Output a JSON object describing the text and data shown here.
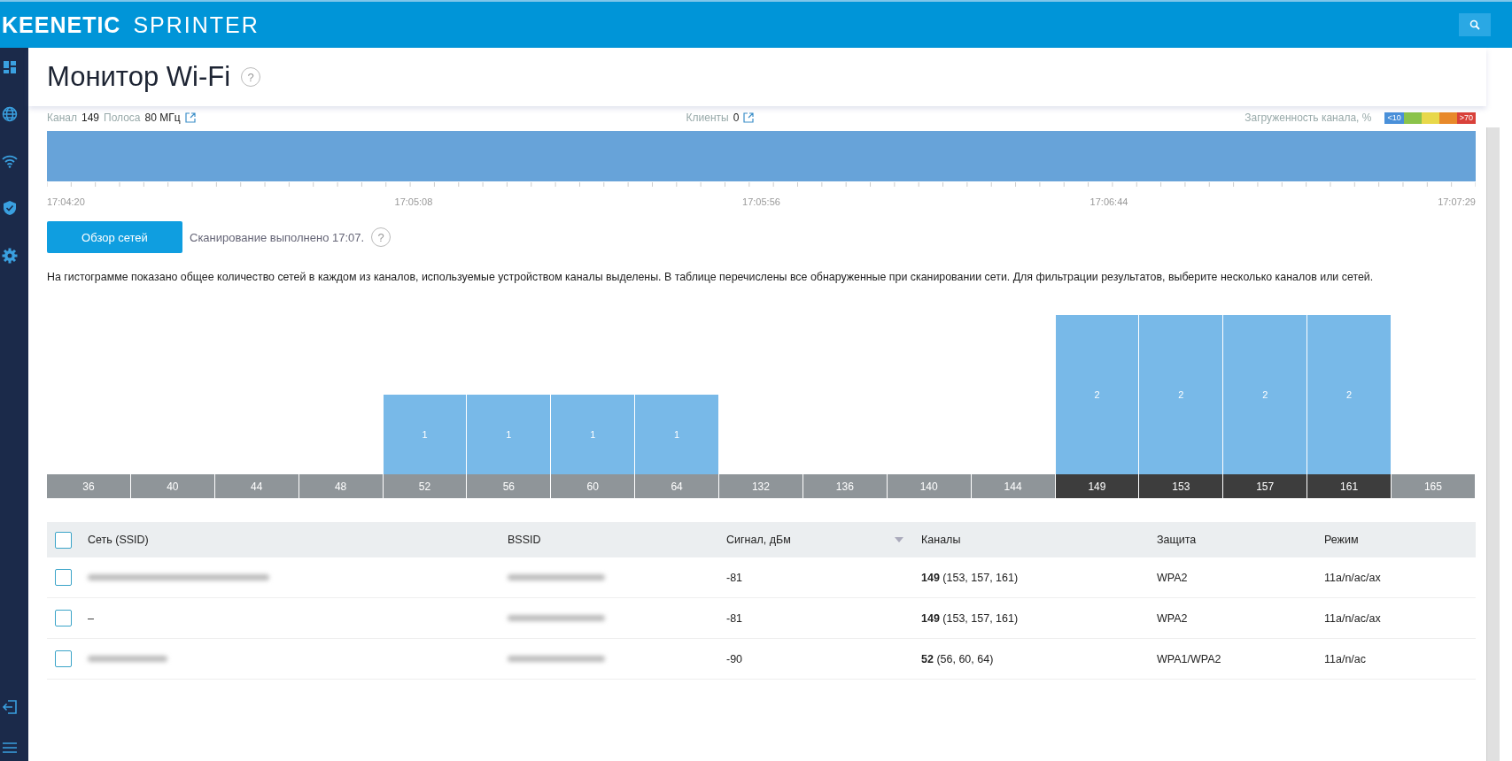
{
  "brand": {
    "name": "KEENETIC",
    "model": "SPRINTER"
  },
  "page": {
    "title": "Монитор Wi-Fi",
    "help": "?"
  },
  "load_strip": {
    "channel_label": "Канал",
    "channel": "149",
    "band_label": "Полоса",
    "band": "80 МГц",
    "clients_label": "Клиенты",
    "clients": "0",
    "load_label": "Загруженность канала, %",
    "legend": [
      {
        "label": "<10",
        "color": "#4a90d9"
      },
      {
        "color": "#8bc34a"
      },
      {
        "color": "#e8d84a"
      },
      {
        "color": "#e8892a"
      },
      {
        "label": ">70",
        "color": "#d9413a"
      }
    ],
    "time_labels": [
      "17:04:20",
      "17:05:08",
      "17:05:56",
      "17:06:44",
      "17:07:29"
    ]
  },
  "scan": {
    "button": "Обзор сетей",
    "status": "Сканирование выполнено 17:07.",
    "help": "?"
  },
  "description": "На гистограмме показано общее количество сетей в каждом из каналов, используемые устройством каналы выделены. В таблице перечислены все обнаруженные при сканировании сети. Для фильтрации результатов, выберите несколько каналов или сетей.",
  "histogram": {
    "chart_data": {
      "type": "bar",
      "categories": [
        "36",
        "40",
        "44",
        "48",
        "52",
        "56",
        "60",
        "64",
        "132",
        "136",
        "140",
        "144",
        "149",
        "153",
        "157",
        "161",
        "165"
      ],
      "values": [
        0,
        0,
        0,
        0,
        1,
        1,
        1,
        1,
        0,
        0,
        0,
        0,
        2,
        2,
        2,
        2,
        0
      ],
      "value_labels": [
        null,
        null,
        null,
        null,
        "1",
        "1",
        "1",
        "1",
        null,
        null,
        null,
        null,
        "2",
        "2",
        "2",
        "2",
        null
      ]
    },
    "highlighted": [
      false,
      false,
      false,
      false,
      false,
      false,
      false,
      false,
      false,
      false,
      false,
      false,
      true,
      true,
      true,
      true,
      false
    ]
  },
  "table": {
    "columns": [
      "Сеть (SSID)",
      "BSSID",
      "Сигнал, дБм",
      "Каналы",
      "Защита",
      "Режим"
    ],
    "select_all": false,
    "rows": [
      {
        "checked": false,
        "ssid_blurred": true,
        "bssid_blurred": true,
        "signal": "-81",
        "channel": "149",
        "channel_extra": "(153, 157, 161)",
        "security": "WPA2",
        "mode": "11a/n/ac/ax"
      },
      {
        "checked": false,
        "ssid": "–",
        "bssid_blurred": true,
        "signal": "-81",
        "channel": "149",
        "channel_extra": "(153, 157, 161)",
        "security": "WPA2",
        "mode": "11a/n/ac/ax"
      },
      {
        "checked": false,
        "ssid_blurred": true,
        "ssid_short": true,
        "bssid_blurred": true,
        "signal": "-90",
        "channel": "52",
        "channel_extra": "(56, 60, 64)",
        "security": "WPA1/WPA2",
        "mode": "11a/n/ac"
      }
    ]
  }
}
